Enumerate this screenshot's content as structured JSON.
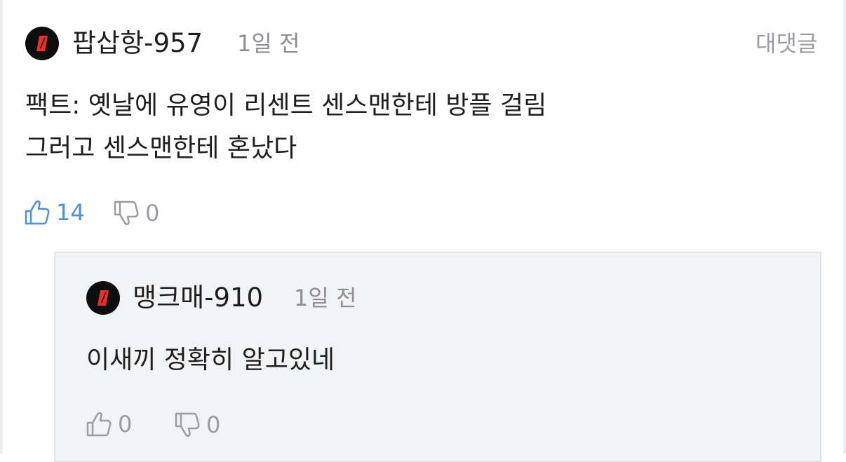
{
  "comment": {
    "username": "팝삽항-957",
    "time": "1일 전",
    "reply_label": "대댓글",
    "lines": [
      "팩트: 옛날에 유영이 리센트 센스맨한테 방플 걸림",
      "그러고 센스맨한테 혼났다"
    ],
    "likes": "14",
    "dislikes": "0"
  },
  "reply": {
    "username": "맹크매-910",
    "time": "1일 전",
    "lines": [
      "이새끼 정확히 알고있네"
    ],
    "likes": "0",
    "dislikes": "0"
  },
  "icons": {
    "avatar": "red-slash-logo",
    "like": "thumbs-up-icon",
    "dislike": "thumbs-down-icon"
  },
  "colors": {
    "accent_like_active": "#4a90e2",
    "muted": "#9a9ca2",
    "avatar_bg": "#0d0d0d",
    "avatar_mark": "#e8302a",
    "reply_bg": "#f2f3f5"
  }
}
